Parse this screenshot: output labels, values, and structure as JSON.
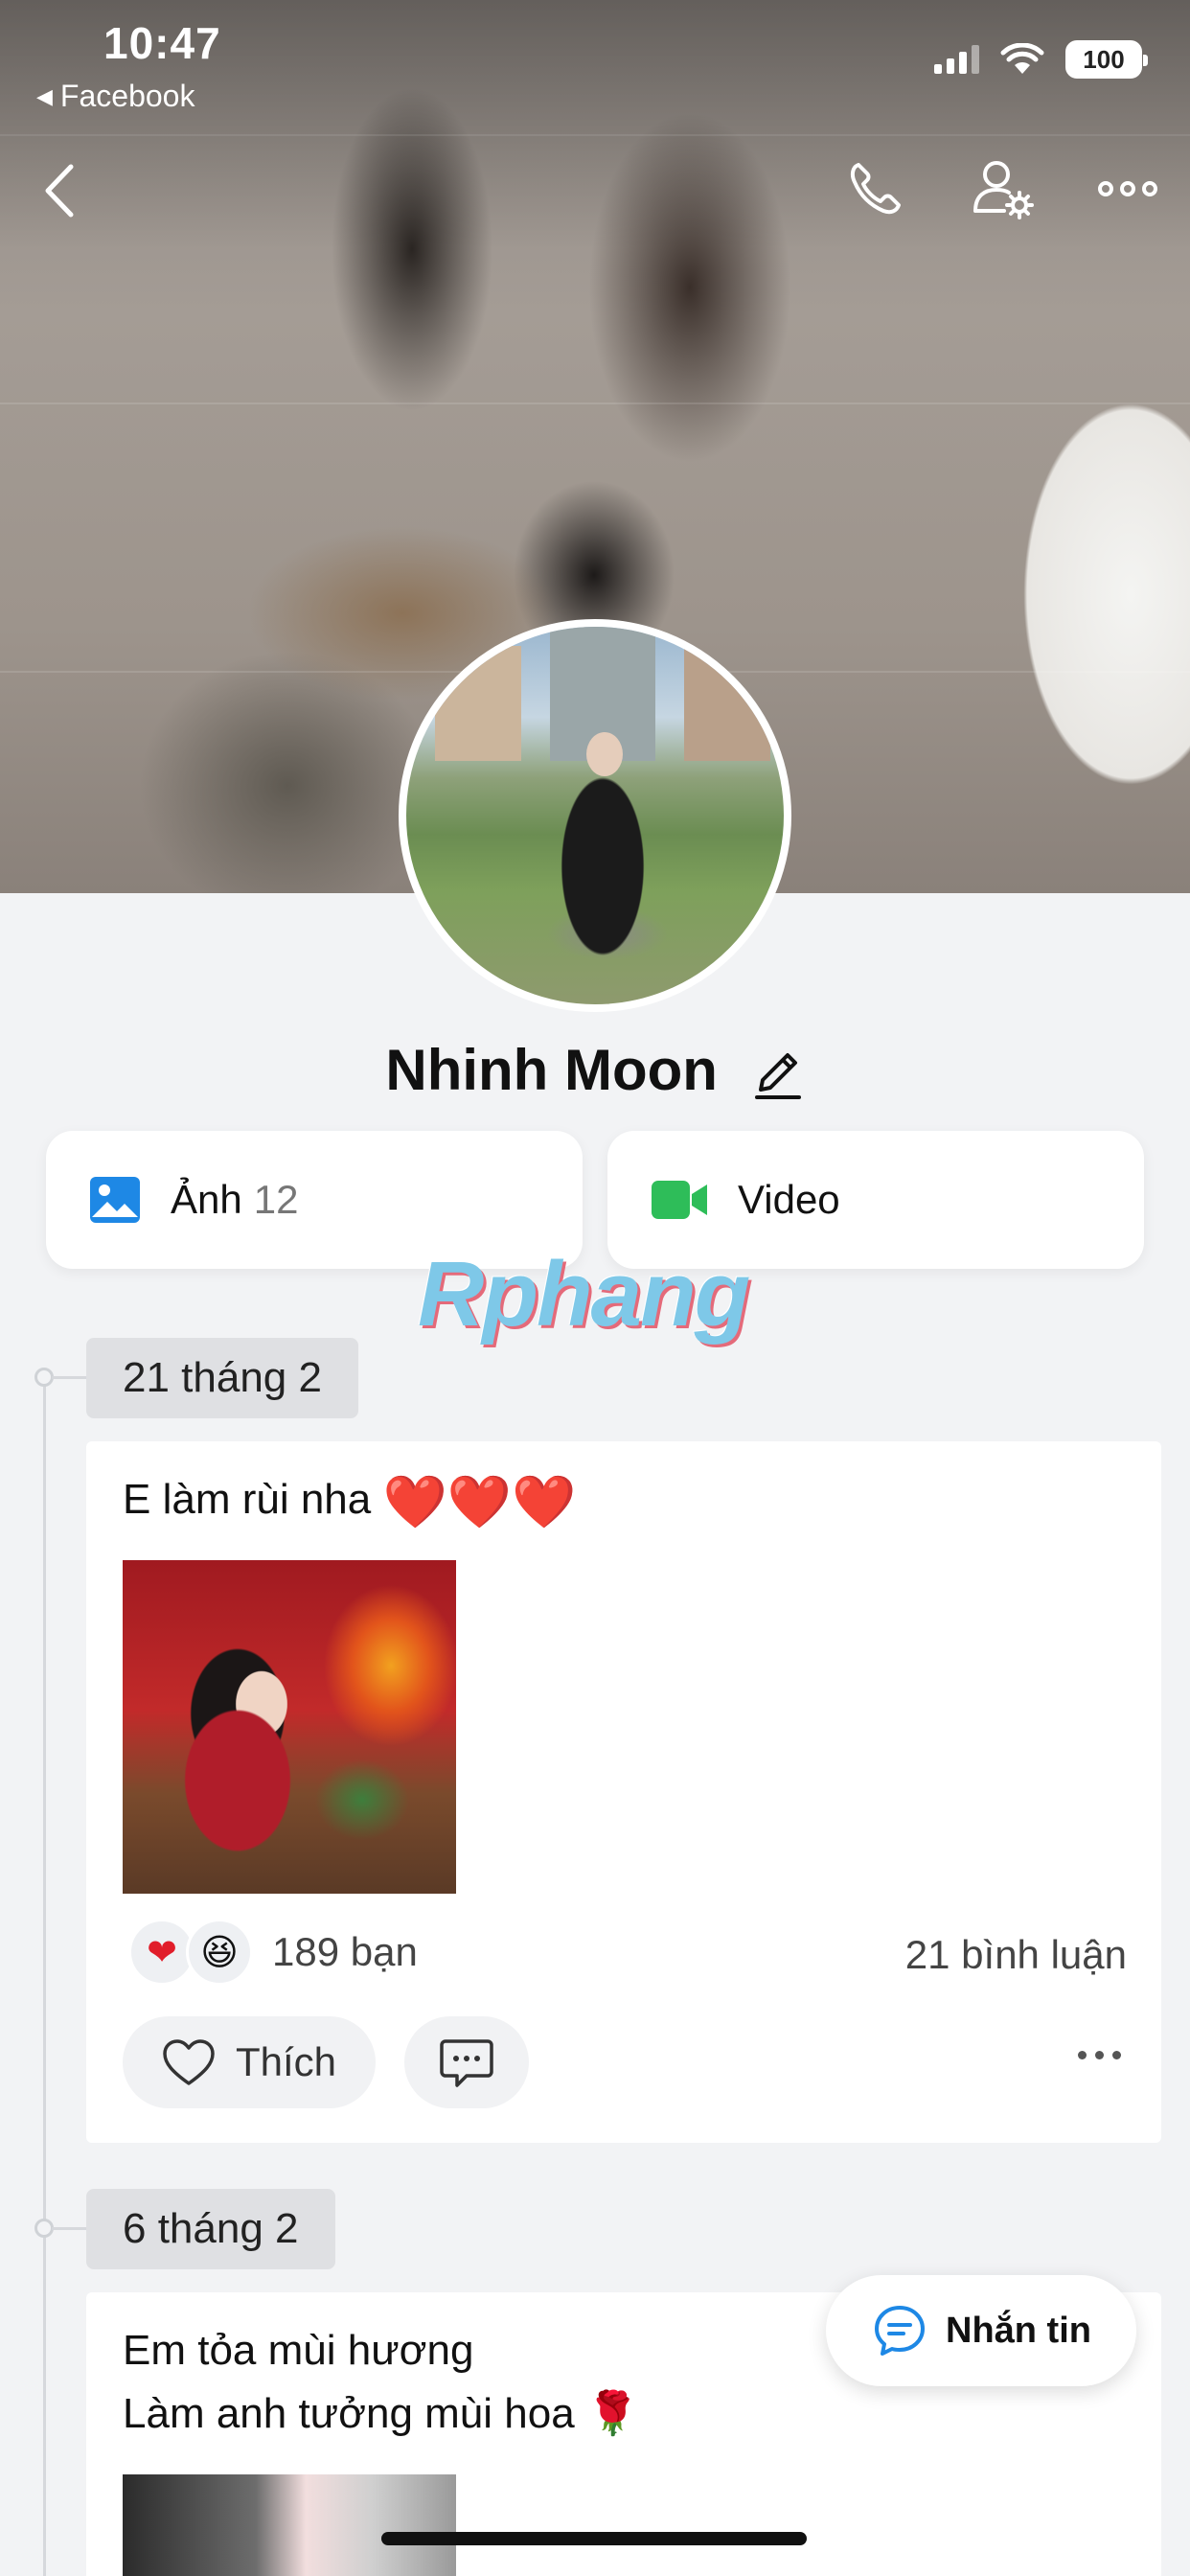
{
  "status_bar": {
    "time": "10:47",
    "back_app": "Facebook",
    "battery": "100"
  },
  "nav": {
    "back_icon": "chevron-left-icon",
    "call_icon": "phone-icon",
    "settings_icon": "user-settings-icon",
    "more_icon": "more-horizontal-icon"
  },
  "profile": {
    "name": "Nhinh Moon"
  },
  "media": {
    "photos_label": "Ảnh",
    "photos_count": "12",
    "video_label": "Video"
  },
  "watermark": "Rphang",
  "timeline": [
    {
      "date": "21 tháng 2",
      "text": "E làm rùi nha",
      "hearts": "❤️❤️❤️",
      "reaction_count": "189 bạn",
      "comment_count": "21 bình luận",
      "like_label": "Thích"
    },
    {
      "date": "6 tháng 2",
      "line1": "Em tỏa mùi hương",
      "line2": "Làm anh tưởng mùi hoa",
      "emoji": "🌹"
    }
  ],
  "message_button": {
    "label": "Nhắn tin"
  },
  "colors": {
    "background": "#f2f3f5",
    "accent_blue": "#1e88e5",
    "video_green": "#2ebd59",
    "heart_red": "#e11d2a"
  }
}
